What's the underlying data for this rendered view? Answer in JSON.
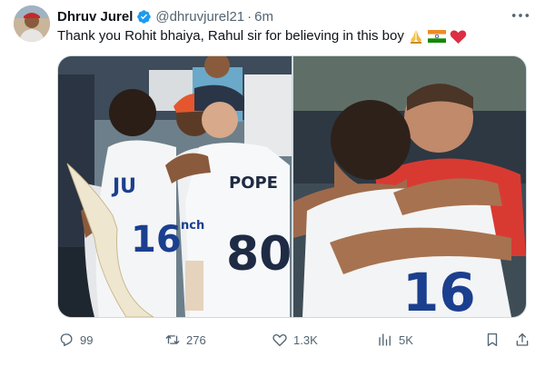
{
  "author": {
    "display_name": "Dhruv Jurel",
    "handle": "@dhruvjurel21",
    "separator": "·",
    "time": "6m",
    "verified": true,
    "avatar_icon": "profile-photo"
  },
  "tweet": {
    "text": "Thank you Rohit bhaiya, Rahul sir for believing in this boy",
    "emojis": [
      "folded-hands",
      "india-flag",
      "red-heart"
    ]
  },
  "media": {
    "photos": [
      {
        "alt": "photo-players-embrace-left",
        "jersey_name": "POPE",
        "jersey_number": "80",
        "back_number": "16",
        "back_name": "JU",
        "sponsor_text": "nch"
      },
      {
        "alt": "photo-players-embrace-right",
        "back_number": "16"
      }
    ]
  },
  "actions": {
    "replies": "99",
    "retweets": "276",
    "likes": "1.3K",
    "views": "5K"
  },
  "colors": {
    "text_primary": "#0f1419",
    "text_secondary": "#536471",
    "verified_blue": "#1d9bf0",
    "border": "#cfd9de"
  }
}
